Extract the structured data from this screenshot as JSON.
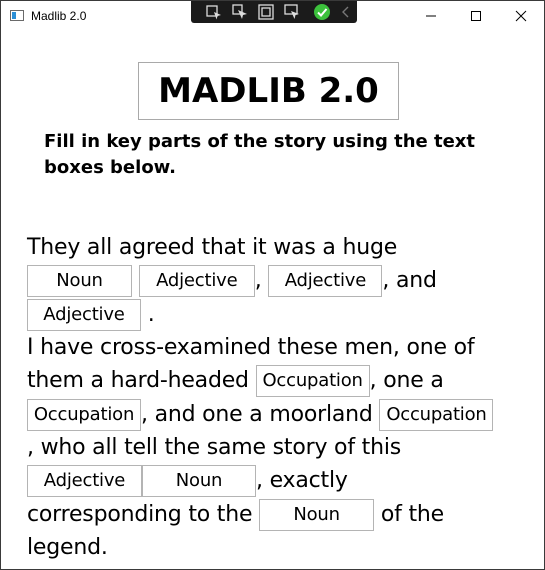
{
  "window": {
    "title": "Madlib 2.0"
  },
  "toolbar_icons": [
    "select-element-icon",
    "pointer-icon",
    "rectangle-icon",
    "track-focus-icon",
    "check-icon",
    "chevron-left-icon"
  ],
  "heading": "MADLIB 2.0",
  "instructions": "Fill in key parts of the story using the text boxes below.",
  "story": {
    "t1": "They all agreed that it was a huge ",
    "b1": "Noun",
    "b2": "Adjective",
    "t2": ", ",
    "b3": "Adjective",
    "t3": ", and ",
    "b4": "Adjective",
    "t4": " .",
    "t5": "I have cross-examined these men, one of them a hard-headed ",
    "b5": "Occupation",
    "t6": ", one a ",
    "b6": "Occupation",
    "t7": ", and one a moorland ",
    "b7": "Occupation",
    "t8": ", who all tell the same story of this ",
    "b8": "Adjective",
    "b9": "Noun",
    "t9": ", exactly corresponding to the ",
    "b10": "Noun",
    "t10": " of the legend."
  },
  "colors": {
    "toolbar_bg": "#1b1b1b",
    "check_green": "#3cc13c",
    "border": "#b4b4b4"
  }
}
